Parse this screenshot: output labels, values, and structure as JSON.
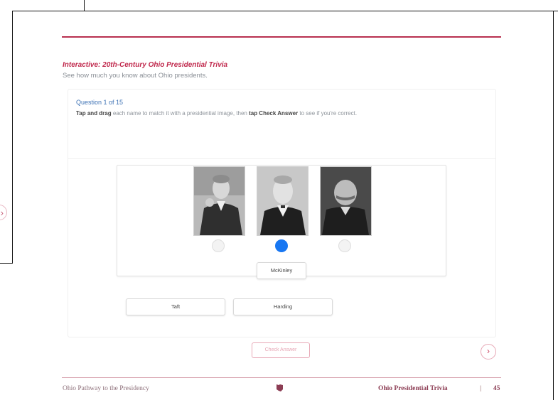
{
  "header": {
    "section_title": "Interactive: 20th-Century Ohio Presidential Trivia",
    "section_subtitle": "See how much you know about Ohio presidents."
  },
  "question": {
    "counter": "Question 1 of 15",
    "instruction_1": "Tap and drag",
    "instruction_2": " each name to match it with a presidential image, then ",
    "instruction_3": "tap Check Answer",
    "instruction_4": " to see if you're correct."
  },
  "portraits": [
    {
      "icon": "portrait-photo"
    },
    {
      "icon": "portrait-photo"
    },
    {
      "icon": "portrait-photo"
    }
  ],
  "drop_targets": [
    {
      "selected": false
    },
    {
      "selected": true
    },
    {
      "selected": false
    }
  ],
  "name_chips": {
    "placed": "McKinley",
    "bank": [
      "Taft",
      "Harding"
    ]
  },
  "buttons": {
    "check_answer": "Check Answer",
    "next_icon": "chevron-right-icon",
    "prev_icon": "chevron-left-icon"
  },
  "footer": {
    "book_title": "Ohio Pathway to the Presidency",
    "chapter_title": "Ohio Presidential Trivia",
    "separator": "|",
    "page_number": "45"
  },
  "colors": {
    "accent": "#c0284c",
    "link_blue": "#3f73b5",
    "selected_blue": "#1877f2"
  }
}
